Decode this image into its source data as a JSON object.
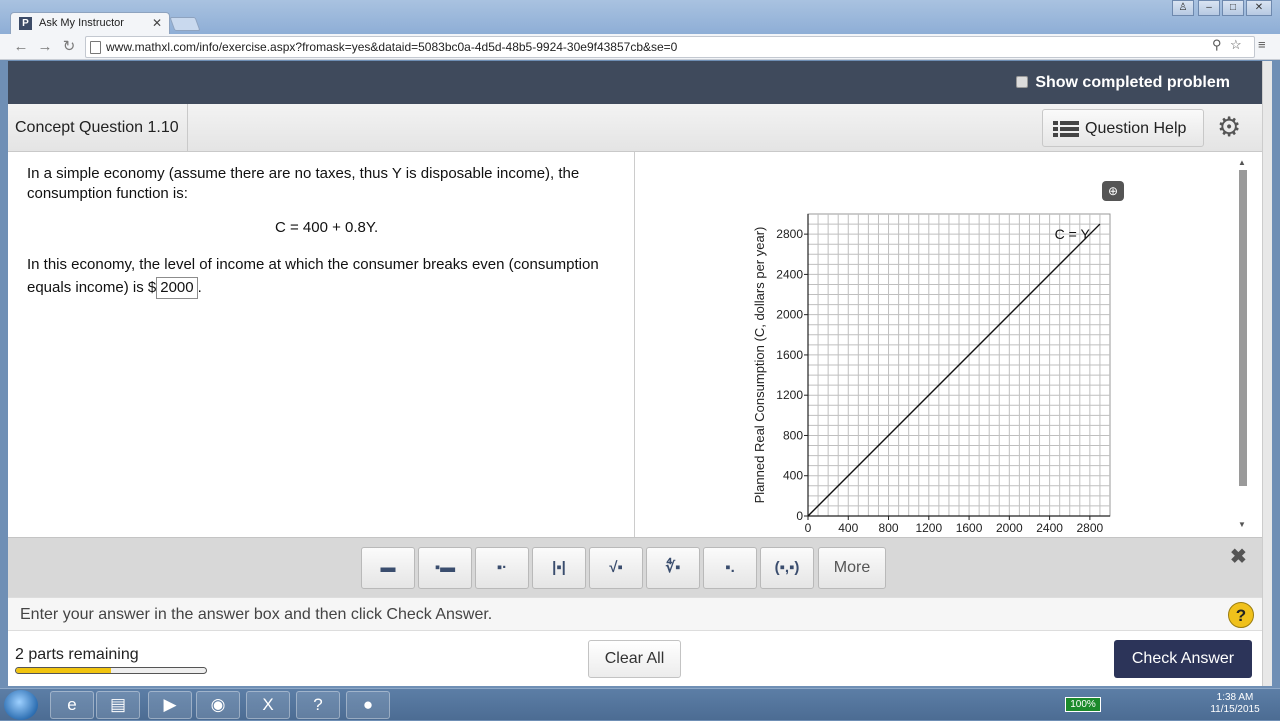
{
  "browser": {
    "tab_title": "Ask My Instructor",
    "tab_favicon": "P",
    "url": "www.mathxl.com/info/exercise.aspx?fromask=yes&dataid=5083bc0a-4d5d-48b5-9924-30e9f43857cb&se=0"
  },
  "header": {
    "show_completed_label": "Show completed problem"
  },
  "question_bar": {
    "title": "Concept Question 1.10",
    "help_label": "Question Help"
  },
  "question": {
    "intro": "In a simple economy (assume there are no taxes, thus Y is disposable income), the consumption function is:",
    "equation": "C = 400 + 0.8Y.",
    "prompt_before": "In this economy, the level of income at which the consumer breaks even (consumption equals income) is $",
    "answer": "2000",
    "prompt_after": "."
  },
  "chart_data": {
    "type": "line",
    "title": "",
    "xlabel": "",
    "ylabel": "Planned Real Consumption (C, dollars per year)",
    "xlim": [
      0,
      3000
    ],
    "ylim": [
      0,
      3000
    ],
    "x_ticks": [
      0,
      400,
      800,
      1200,
      1600,
      2000,
      2400,
      2800
    ],
    "y_ticks": [
      0,
      400,
      800,
      1200,
      1600,
      2000,
      2400,
      2800
    ],
    "grid": true,
    "series": [
      {
        "name": "C = Y",
        "x": [
          0,
          2900
        ],
        "y": [
          0,
          2900
        ]
      }
    ],
    "annotations": [
      {
        "text": "C = Y",
        "x": 2450,
        "y": 2800
      }
    ]
  },
  "math_tools": {
    "buttons": [
      "fraction",
      "mixed-number",
      "exponent",
      "absolute-value",
      "square-root",
      "nth-root",
      "subscript",
      "ordered-pair"
    ],
    "button_glyphs": [
      "▬",
      "▪▬",
      "▪·",
      "|▪|",
      "√▪",
      "∜▪",
      "▪.",
      "(▪,▪)"
    ],
    "more_label": "More"
  },
  "instruction": {
    "text": "Enter your answer in the answer box and then click Check Answer."
  },
  "footer": {
    "parts_remaining": "2 parts remaining",
    "progress": 0.5,
    "clear_all": "Clear All",
    "check_answer": "Check Answer"
  },
  "taskbar": {
    "battery": "100%",
    "time": "1:38 AM",
    "date": "11/15/2015",
    "items": [
      "ie-icon",
      "folder-icon",
      "media-icon",
      "chrome-icon",
      "excel-icon",
      "help-icon",
      "obs-icon"
    ]
  },
  "colors": {
    "header_band": "#3f4a5c",
    "check_answer_bg": "#2c3459",
    "progress_fill": "#f1c40f"
  }
}
